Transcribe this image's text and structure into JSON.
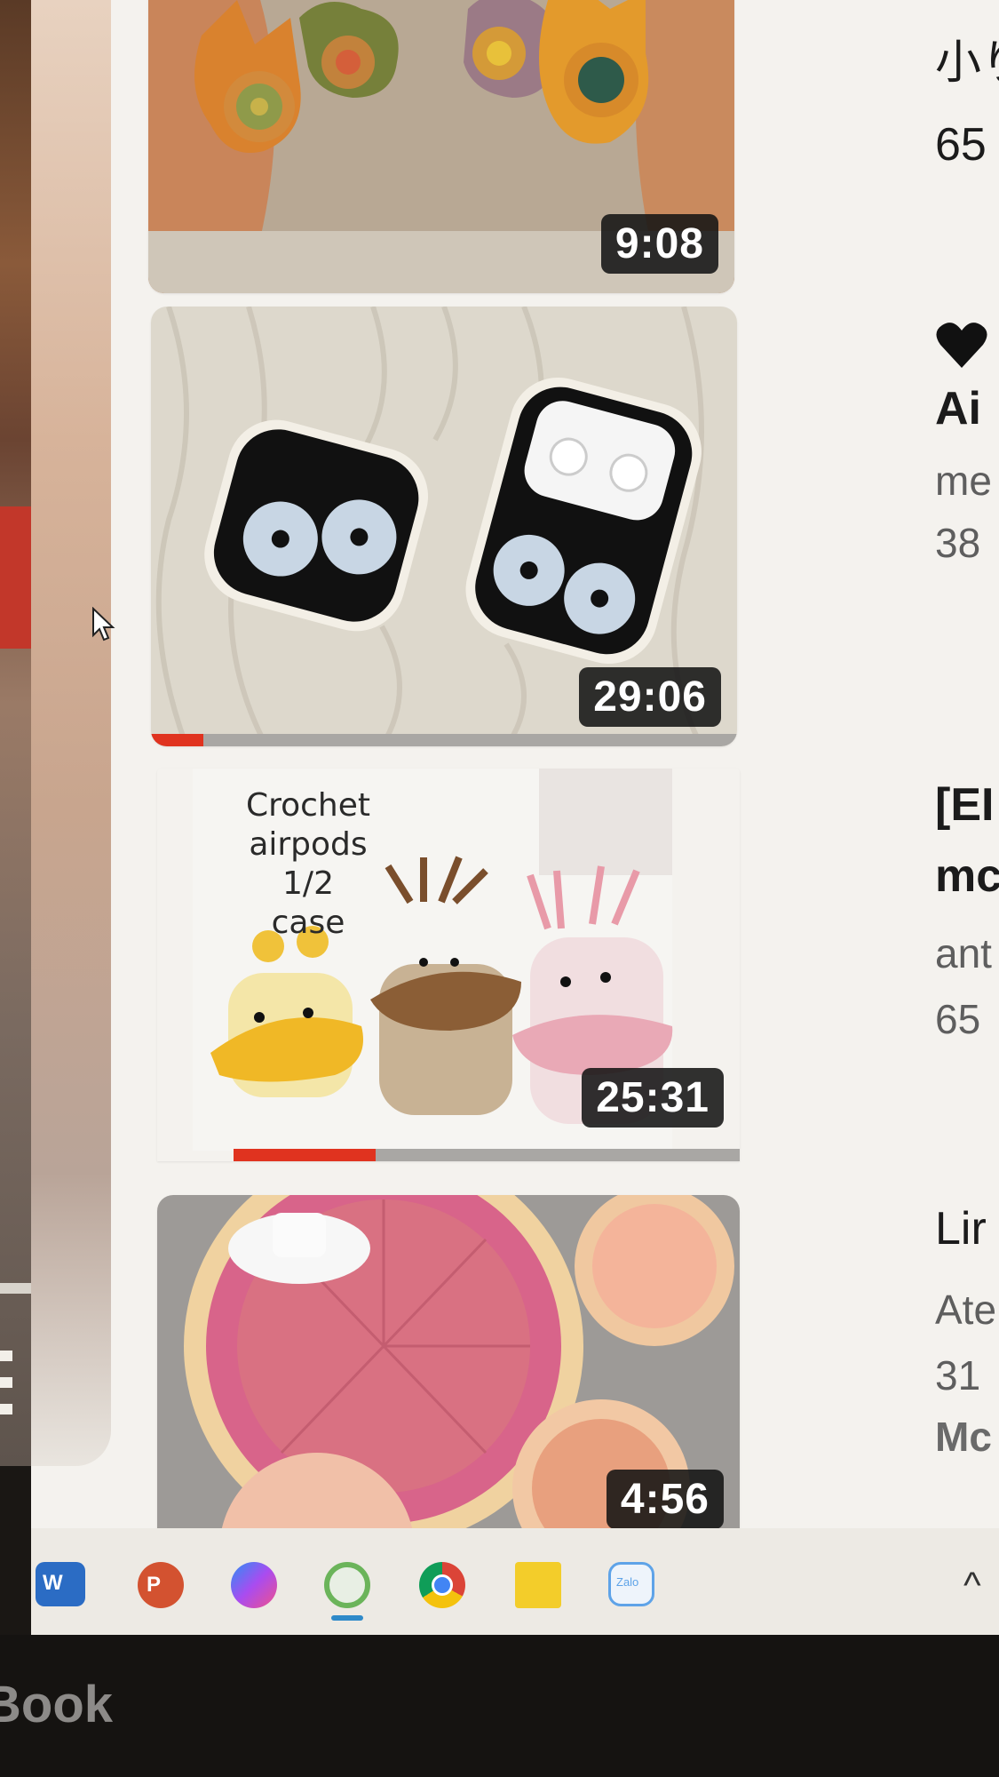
{
  "videos": [
    {
      "duration": "9:08",
      "title_fragment": "小り",
      "stat_fragment": "65",
      "progress": 0
    },
    {
      "duration": "29:06",
      "title_fragment": "Ai",
      "channel_fragment": "me",
      "stat_fragment": "38",
      "progress": 0.09
    },
    {
      "duration": "25:31",
      "thumbnail_caption": [
        "Crochet",
        "airpods 1/2",
        "case"
      ],
      "title_fragment": "[EI",
      "title_line2_fragment": "mc",
      "channel_fragment": "ant",
      "stat_fragment": "65",
      "progress": 0.28
    },
    {
      "duration": "4:56",
      "title_fragment": "Lir",
      "channel_fragment": "Ate",
      "stat_fragment": "31",
      "more_fragment": "Mc",
      "progress": 0
    }
  ],
  "taskbar": {
    "icons": [
      "word-icon",
      "powerpoint-icon",
      "messenger-icon",
      "kaspersky-icon",
      "chrome-icon",
      "sticky-notes-icon",
      "zalo-icon"
    ],
    "zalo_label": "Zalo",
    "word_letter": "W",
    "powerpoint_letter": "P",
    "tray_chevron": "^"
  },
  "laptop": {
    "brand_fragment": "Book"
  },
  "colors": {
    "progress_red": "#e0331f",
    "screen_bg": "#f4f2ee"
  }
}
